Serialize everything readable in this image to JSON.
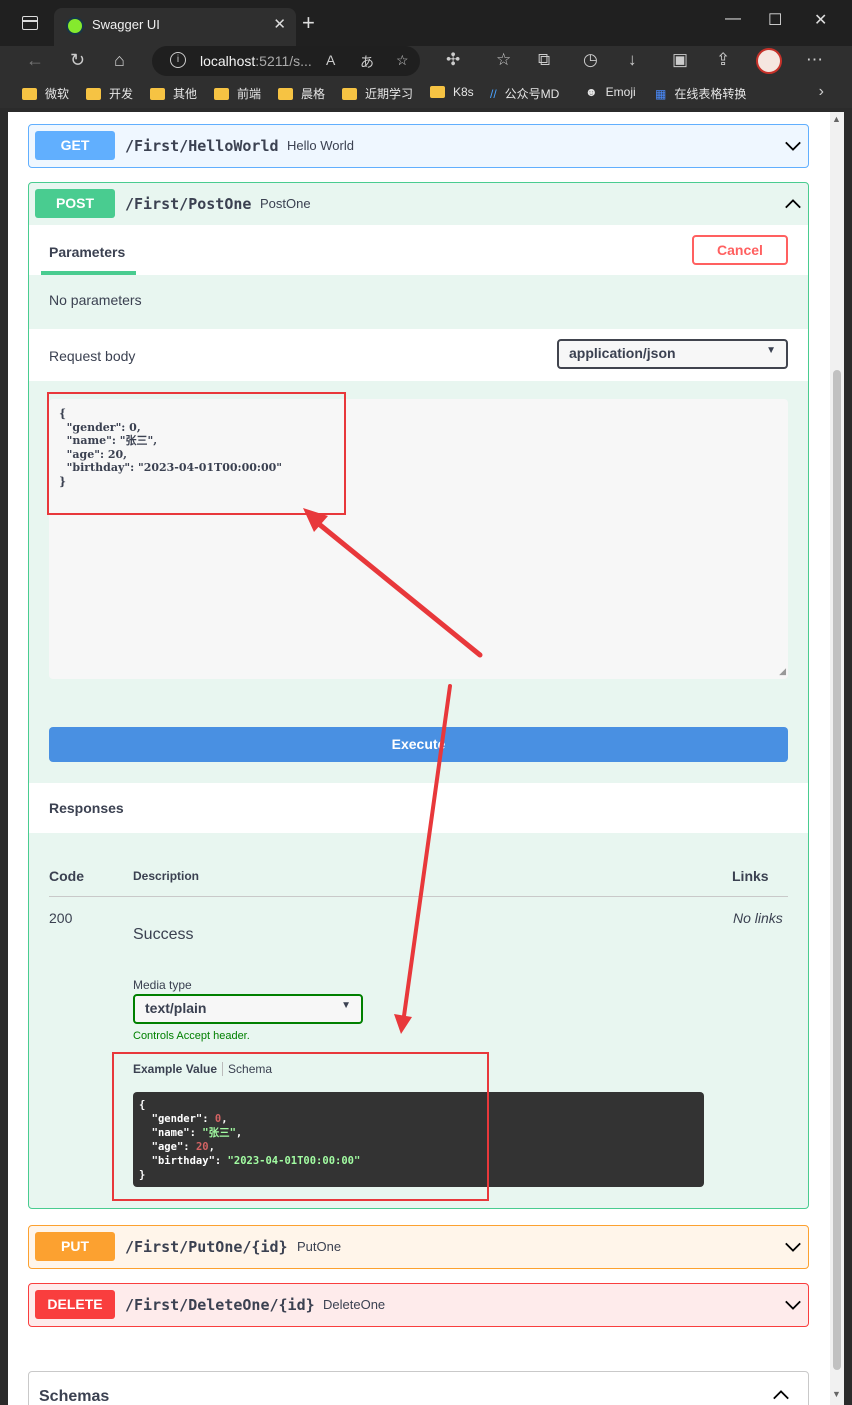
{
  "browser": {
    "tab_title": "Swagger UI",
    "tab_close": "✕",
    "new_tab": "+",
    "window_controls": [
      "—",
      "☐",
      "✕"
    ],
    "url_host": "localhost",
    "url_rest": ":5211/s...",
    "bookmarks": [
      "微软",
      "开发",
      "其他",
      "前端",
      "晨格",
      "近期学习",
      "K8s",
      "公众号MD",
      "Emoji",
      "在线表格转换"
    ]
  },
  "ops": {
    "get": {
      "method": "GET",
      "path": "/First/HelloWorld",
      "desc": "Hello World",
      "color": "#61affe"
    },
    "post": {
      "method": "POST",
      "path": "/First/PostOne",
      "desc": "PostOne",
      "color": "#49cc90"
    },
    "put": {
      "method": "PUT",
      "path": "/First/PutOne/{id}",
      "desc": "PutOne",
      "color": "#fca130"
    },
    "delete": {
      "method": "DELETE",
      "path": "/First/DeleteOne/{id}",
      "desc": "DeleteOne",
      "color": "#f93e3e"
    }
  },
  "post_detail": {
    "parameters_tab": "Parameters",
    "cancel": "Cancel",
    "no_params": "No parameters",
    "request_body_label": "Request body",
    "content_type": "application/json",
    "request_body_text": "{\n  \"gender\": 0,\n  \"name\": \"张三\",\n  \"age\": 20,\n  \"birthday\": \"2023-04-01T00:00:00\"\n}",
    "execute": "Execute",
    "responses_title": "Responses",
    "col_code": "Code",
    "col_description": "Description",
    "col_links": "Links",
    "code": "200",
    "no_links": "No links",
    "success": "Success",
    "media_type_label": "Media type",
    "media_type": "text/plain",
    "accept_note": "Controls Accept header.",
    "example_tab": "Example Value",
    "schema_tab": "Schema",
    "example": [
      {
        "key": "gender",
        "value": "0",
        "kind": "number"
      },
      {
        "key": "name",
        "value": "\"张三\"",
        "kind": "string"
      },
      {
        "key": "age",
        "value": "20",
        "kind": "number"
      },
      {
        "key": "birthday",
        "value": "\"2023-04-01T00:00:00\"",
        "kind": "string"
      }
    ]
  },
  "schemas_title": "Schemas",
  "colors": {
    "annotation": "#e8383b",
    "execute": "#4990e2"
  }
}
